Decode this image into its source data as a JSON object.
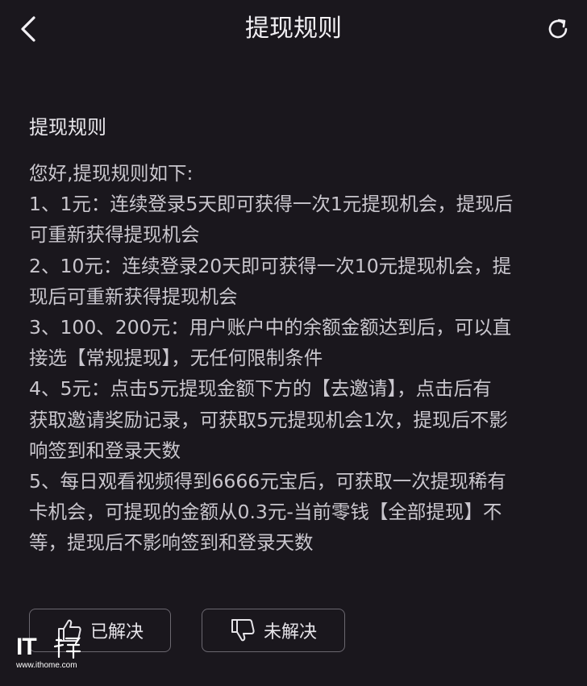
{
  "header": {
    "title": "提现规则",
    "back_icon": "chevron-left-icon",
    "refresh_icon": "refresh-icon"
  },
  "content": {
    "section_title": "提现规则",
    "lines": [
      "您好,提现规则如下:",
      "1、1元：连续登录5天即可获得一次1元提现机会，提现后",
      "可重新获得提现机会",
      "2、10元：连续登录20天即可获得一次10元提现机会，提",
      "现后可重新获得提现机会",
      "3、100、200元：用户账户中的余额金额达到后，可以直",
      "接选【常规提现】，无任何限制条件",
      "4、5元：点击5元提现金额下方的【去邀请】，点击后有",
      "获取邀请奖励记录，可获取5元提现机会1次，提现后不影",
      "响签到和登录天数",
      "5、每日观看视频得到6666元宝后，可获取一次提现稀有",
      "卡机会，可提现的金额从0.3元-当前零钱【全部提现】不",
      "等，提现后不影响签到和登录天数"
    ]
  },
  "feedback": {
    "resolved_label": "已解决",
    "unresolved_label": "未解决",
    "resolved_icon": "thumbs-up-icon",
    "unresolved_icon": "thumbs-down-icon"
  },
  "watermark": {
    "logo": "IT",
    "url": "www.ithome.com"
  },
  "colors": {
    "background": "#1a171d",
    "text": "#c9c6cd",
    "title": "#f2f0f4",
    "button_border": "#6b6870"
  }
}
